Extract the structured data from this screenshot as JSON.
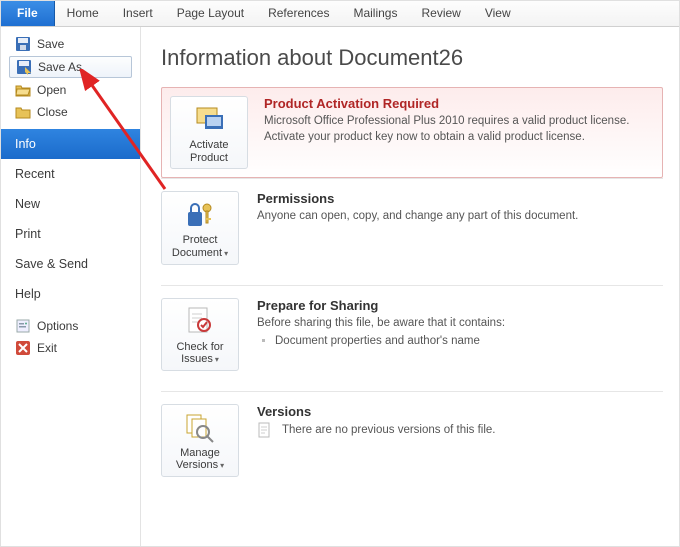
{
  "ribbon": {
    "tabs": [
      "File",
      "Home",
      "Insert",
      "Page Layout",
      "References",
      "Mailings",
      "Review",
      "View"
    ]
  },
  "backstage": {
    "save": "Save",
    "save_as": "Save As",
    "open": "Open",
    "close": "Close",
    "info": "Info",
    "recent": "Recent",
    "new": "New",
    "print": "Print",
    "save_send": "Save & Send",
    "help": "Help",
    "options": "Options",
    "exit": "Exit"
  },
  "page": {
    "title": "Information about Document26"
  },
  "activation": {
    "button": "Activate Product",
    "title": "Product Activation Required",
    "body": "Microsoft Office Professional Plus 2010 requires a valid product license. Activate your product key now to obtain a valid product license."
  },
  "permissions": {
    "button": "Protect Document",
    "title": "Permissions",
    "body": "Anyone can open, copy, and change any part of this document."
  },
  "prepare": {
    "button": "Check for Issues",
    "title": "Prepare for Sharing",
    "lead": "Before sharing this file, be aware that it contains:",
    "item1": "Document properties and author's name"
  },
  "versions": {
    "button": "Manage Versions",
    "title": "Versions",
    "body": "There are no previous versions of this file."
  }
}
